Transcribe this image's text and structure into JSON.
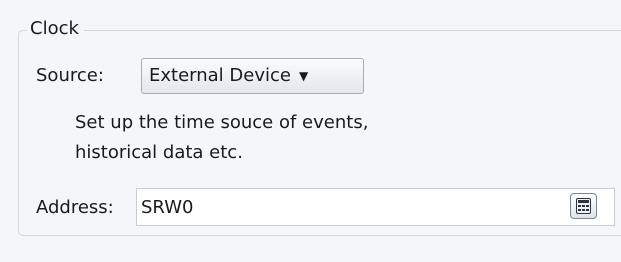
{
  "clock_group": {
    "title": "Clock",
    "source_label": "Source:",
    "source_value": "External Device",
    "source_arrow": "▼",
    "description_line1": "Set up the time souce of events,",
    "description_line2": "historical data etc.",
    "address_label": "Address:",
    "address_value": "SRW0",
    "address_button_icon": "calculator-icon"
  }
}
